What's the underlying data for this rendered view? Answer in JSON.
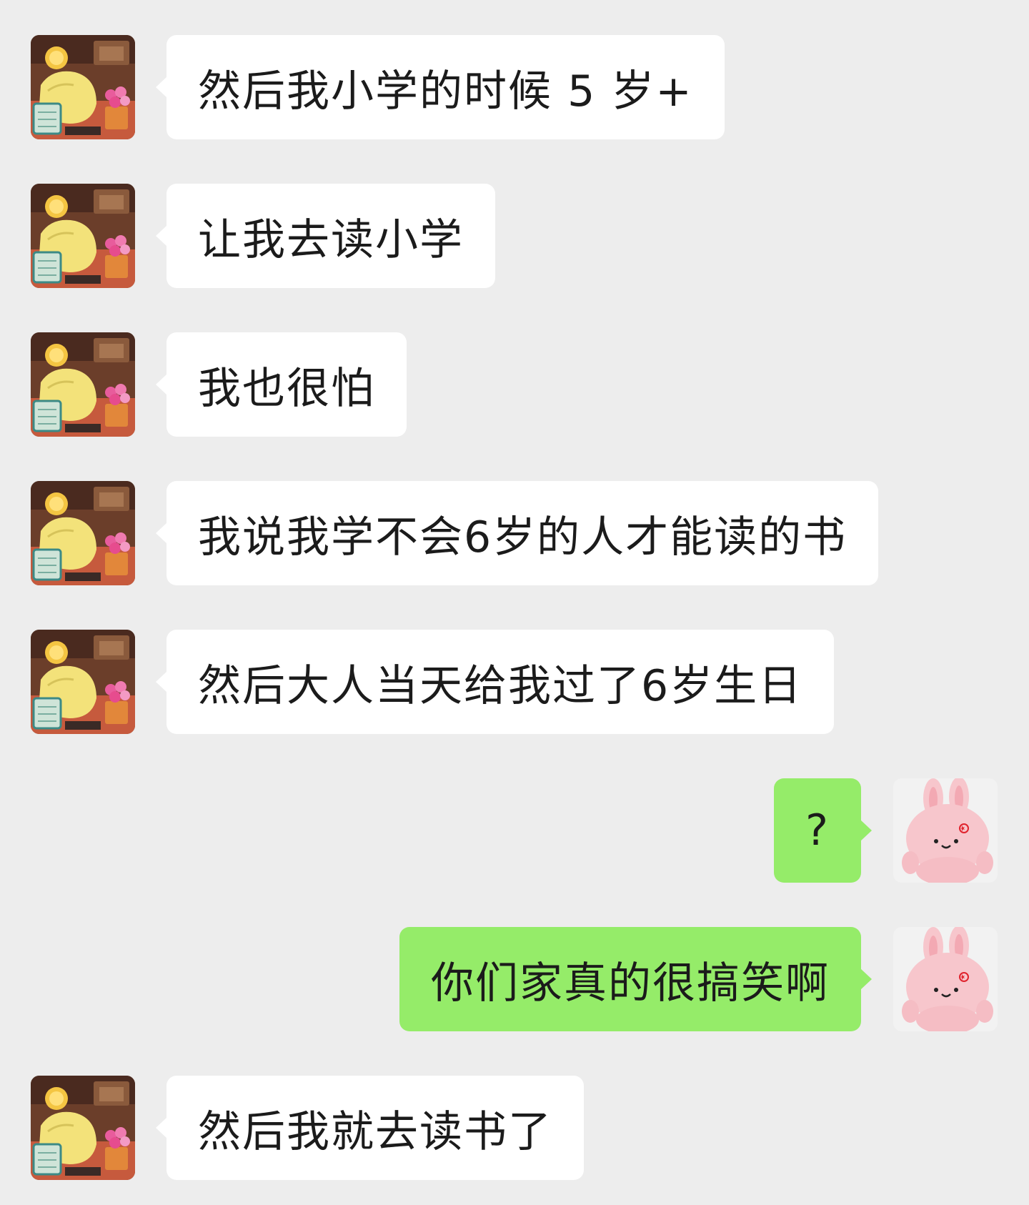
{
  "colors": {
    "background": "#ededed",
    "incoming_bubble": "#ffffff",
    "outgoing_bubble": "#95ec69",
    "text": "#1b1b1b"
  },
  "contact_avatar_icon": "yellow-toy-flowers-avatar",
  "self_avatar_icon": "pink-bunny-plush-avatar",
  "messages": [
    {
      "sender": "contact",
      "text": "然后我小学的时候 5 岁+"
    },
    {
      "sender": "contact",
      "text": "让我去读小学"
    },
    {
      "sender": "contact",
      "text": "我也很怕"
    },
    {
      "sender": "contact",
      "text": "我说我学不会6岁的人才能读的书"
    },
    {
      "sender": "contact",
      "text": "然后大人当天给我过了6岁生日"
    },
    {
      "sender": "self",
      "text": "?"
    },
    {
      "sender": "self",
      "text": "你们家真的很搞笑啊"
    },
    {
      "sender": "contact",
      "text": "然后我就去读书了"
    }
  ]
}
